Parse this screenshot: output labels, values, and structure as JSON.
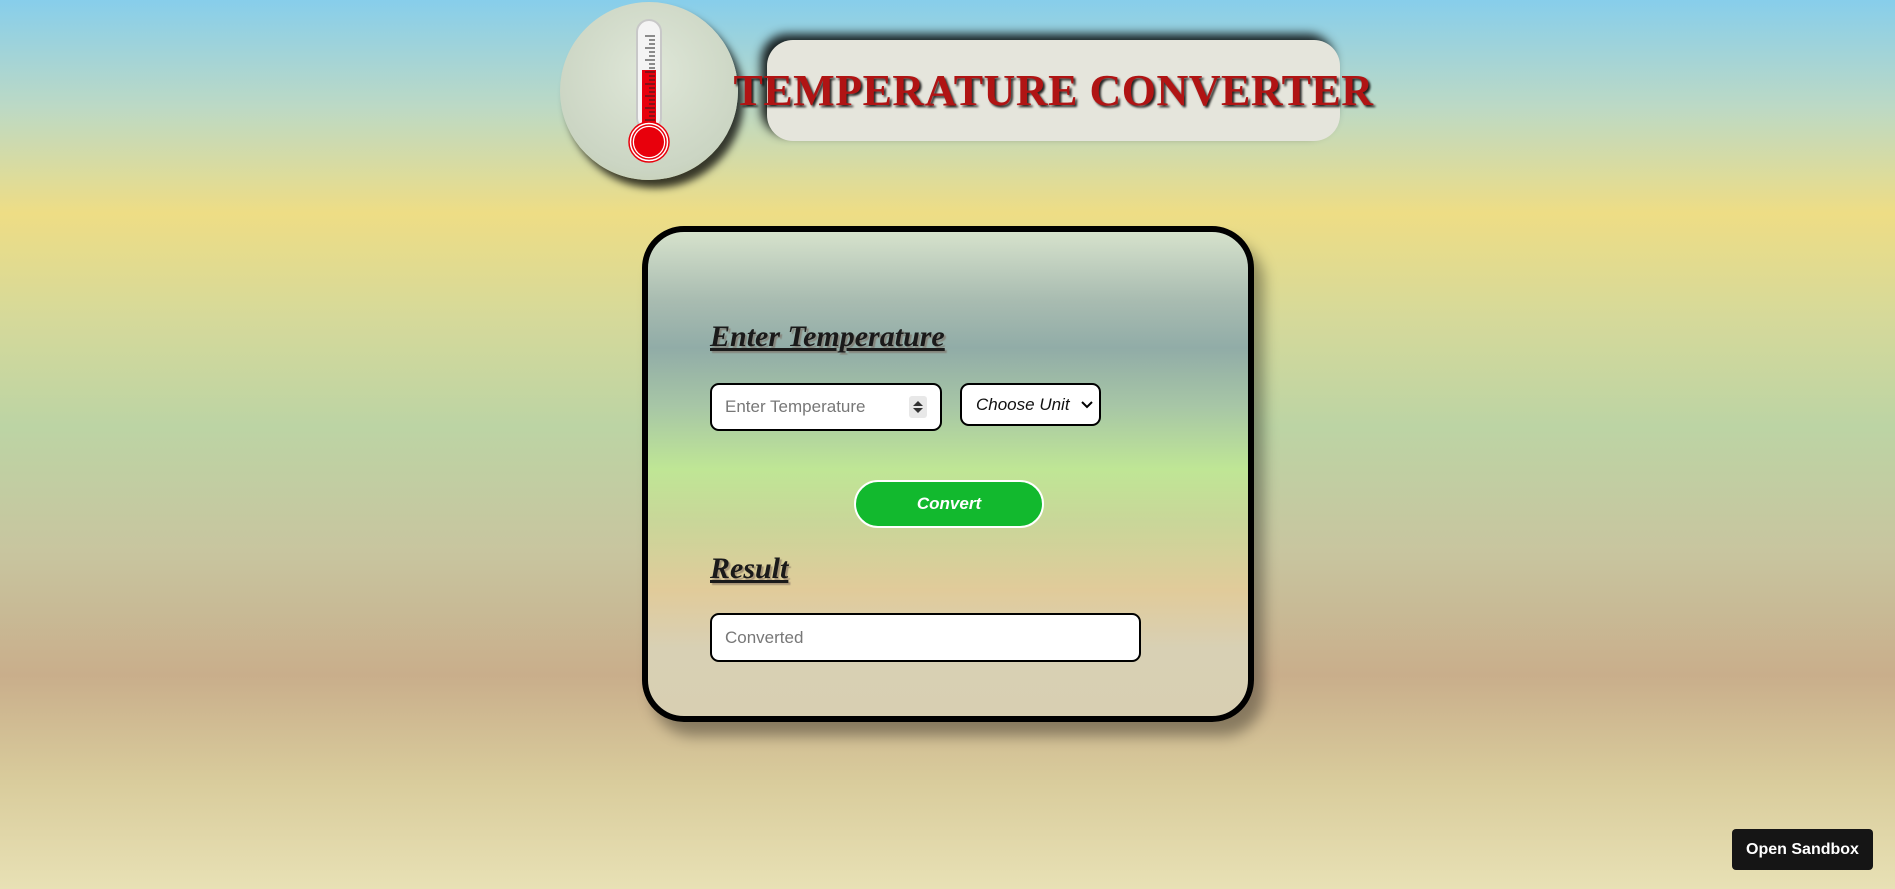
{
  "header": {
    "title": "TEMPERATURE CONVERTER",
    "logo_icon": "thermometer-icon"
  },
  "form": {
    "enter_heading": "Enter Temperature",
    "temperature_input": {
      "placeholder": "Enter Temperature",
      "value": ""
    },
    "unit_select": {
      "selected": "Choose Unit"
    },
    "convert_label": "Convert",
    "result_heading": "Result",
    "result_field": {
      "placeholder": "Converted",
      "value": ""
    }
  },
  "sandbox": {
    "label": "Open Sandbox"
  },
  "colors": {
    "title": "#b01414",
    "convert_button": "#12b92e",
    "thermometer_mercury": "#e8000c"
  }
}
